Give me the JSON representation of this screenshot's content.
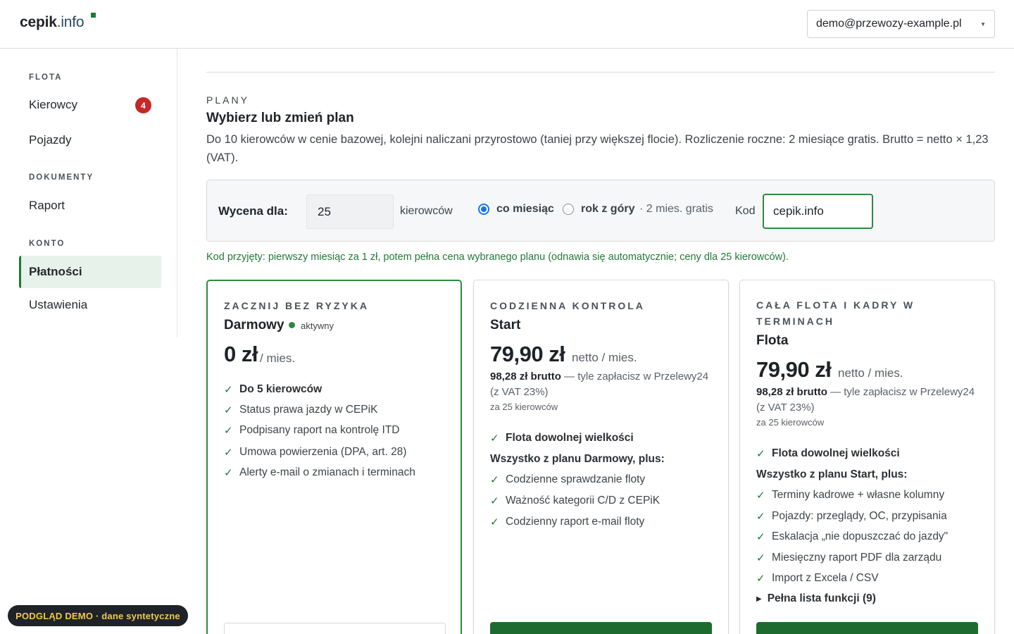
{
  "header": {
    "logo_bold": "cepik",
    "logo_rest": ".info",
    "account_email": "demo@przewozy-example.pl"
  },
  "sidebar": {
    "sections": [
      {
        "label": "FLOTA"
      },
      {
        "label": "DOKUMENTY"
      },
      {
        "label": "KONTO"
      }
    ],
    "items": [
      {
        "label": "Kierowcy",
        "badge": "4"
      },
      {
        "label": "Pojazdy"
      },
      {
        "label": "Raport"
      },
      {
        "label": "Płatności",
        "active": true
      },
      {
        "label": "Ustawienia"
      }
    ]
  },
  "plans": {
    "kicker": "PLANY",
    "title": "Wybierz lub zmień plan",
    "description": "Do 10 kierowców w cenie bazowej, kolejni naliczani przyrostowo (taniej przy większej flocie). Rozliczenie roczne: 2 miesiące gratis. Brutto = netto × 1,23 (VAT).",
    "pricing": {
      "label": "Wycena dla:",
      "drivers_value": "25",
      "drivers_unit": "kierowców",
      "option_monthly": "co miesiąc",
      "option_yearly": "rok z góry",
      "option_yearly_extra": "· 2 mies. gratis",
      "selected": "monthly",
      "code_label": "Kod",
      "code_value": "cepik.info"
    },
    "code_accepted": "Kod przyjęty: pierwszy miesiąc za 1 zł, potem pełna cena wybranego planu (odnawia się automatycznie; ceny dla 25 kierowców).",
    "cards": [
      {
        "kicker": "ZACZNIJ BEZ RYZYKA",
        "name": "Darmowy",
        "status": "aktywny",
        "price": "0 zł",
        "per": "/ mies.",
        "features": [
          {
            "text": "Do 5 kierowców",
            "bold": true
          },
          {
            "text": "Status prawa jazdy w CEPiK"
          },
          {
            "text": "Podpisany raport na kontrolę ITD"
          },
          {
            "text": "Umowa powierzenia (DPA, art. 28)"
          },
          {
            "text": "Alerty e-mail o zmianach i terminach"
          }
        ]
      },
      {
        "kicker": "CODZIENNA KONTROLA",
        "name": "Start",
        "price": "79,90 zł",
        "per": "netto / mies.",
        "gross_bold": "98,28 zł brutto",
        "gross_rest": "— tyle zapłacisz w Przelewy24 (z VAT 23%)",
        "for_drivers": "za 25 kierowców",
        "top_feature": "Flota dowolnej wielkości",
        "includes": "Wszystko z planu Darmowy, plus:",
        "features": [
          {
            "text": "Codzienne sprawdzanie floty"
          },
          {
            "text": "Ważność kategorii C/D z CEPiK"
          },
          {
            "text": "Codzienny raport e-mail floty"
          }
        ]
      },
      {
        "kicker": "CAŁA FLOTA I KADRY W TERMINACH",
        "name": "Flota",
        "price": "79,90 zł",
        "per": "netto / mies.",
        "gross_bold": "98,28 zł brutto",
        "gross_rest": "— tyle zapłacisz w Przelewy24 (z VAT 23%)",
        "for_drivers": "za 25 kierowców",
        "top_feature": "Flota dowolnej wielkości",
        "includes": "Wszystko z planu Start, plus:",
        "features": [
          {
            "text": "Terminy kadrowe + własne kolumny"
          },
          {
            "text": "Pojazdy: przeglądy, OC, przypisania"
          },
          {
            "text": "Eskalacja „nie dopuszczać do jazdy\""
          },
          {
            "text": "Miesięczny raport PDF dla zarządu"
          },
          {
            "text": "Import z Excela / CSV"
          }
        ],
        "more": "Pełna lista funkcji (9)"
      }
    ]
  },
  "demo_pill": "PODGLĄD DEMO · dane syntetyczne"
}
